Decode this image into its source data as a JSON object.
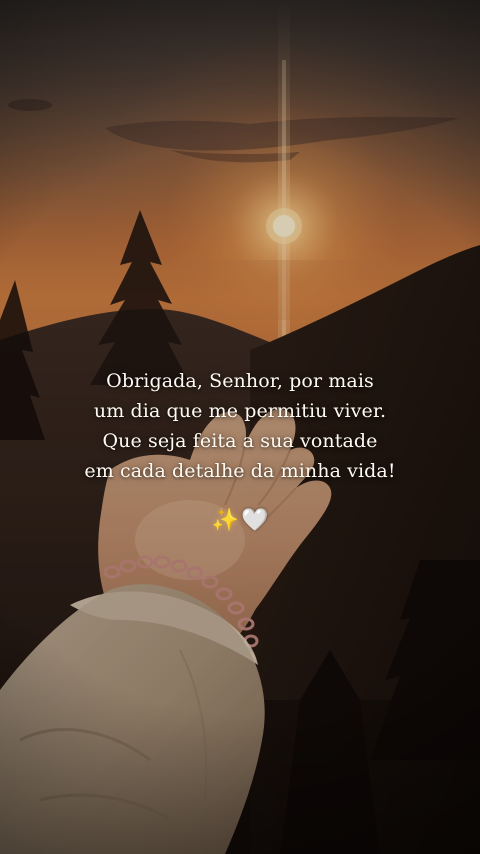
{
  "quote": {
    "line1": "Obrigada, Senhor, por mais",
    "line2": "um dia que me permitiu viver.",
    "line3": "Que seja feita a sua vontade",
    "line4": "em cada detalhe da minha vida!"
  },
  "emojis": {
    "sparkles": "✨",
    "heart": "🤍"
  },
  "colors": {
    "sky_top": "#4a4440",
    "sky_glow": "#e08a45",
    "sun": "#fff6d6",
    "text": "#fffaf2"
  }
}
